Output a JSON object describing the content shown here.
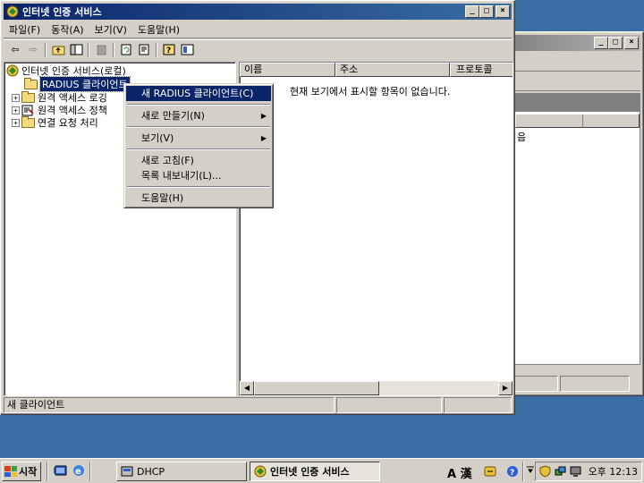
{
  "main_window": {
    "title": "인터넷 인증 서비스",
    "menu": [
      "파일(F)",
      "동작(A)",
      "보기(V)",
      "도움말(H)"
    ],
    "tree": {
      "root": "인터넷 인증 서비스(로컬)",
      "items": [
        "RADIUS 클라이언트",
        "원격 액세스 로깅",
        "원격 액세스 정책",
        "연결 요청 처리"
      ]
    },
    "columns": [
      "이름",
      "주소",
      "프로토콜"
    ],
    "empty_message": "현재 보기에서 표시할 항목이 없습니다.",
    "status_text": "새 클라이언트"
  },
  "context_menu": {
    "items": [
      {
        "label": "새 RADIUS 클라이언트(C)",
        "highlighted": true
      },
      {
        "label": "새로 만들기(N)",
        "submenu": true
      },
      {
        "label": "보기(V)",
        "submenu": true
      },
      {
        "label": "새로 고침(F)"
      },
      {
        "label": "목록 내보내기(L)..."
      },
      {
        "label": "도움말(H)"
      }
    ]
  },
  "background_window": {
    "partial_text": "음"
  },
  "taskbar": {
    "start_label": "시작",
    "buttons": [
      "DHCP",
      "인터넷 인증 서비스"
    ],
    "ime_text": "A 漢",
    "clock": "오후 12:13"
  },
  "colors": {
    "title_active": "#0a246a",
    "desktop": "#3a6ea5",
    "face": "#d4d0c8"
  }
}
